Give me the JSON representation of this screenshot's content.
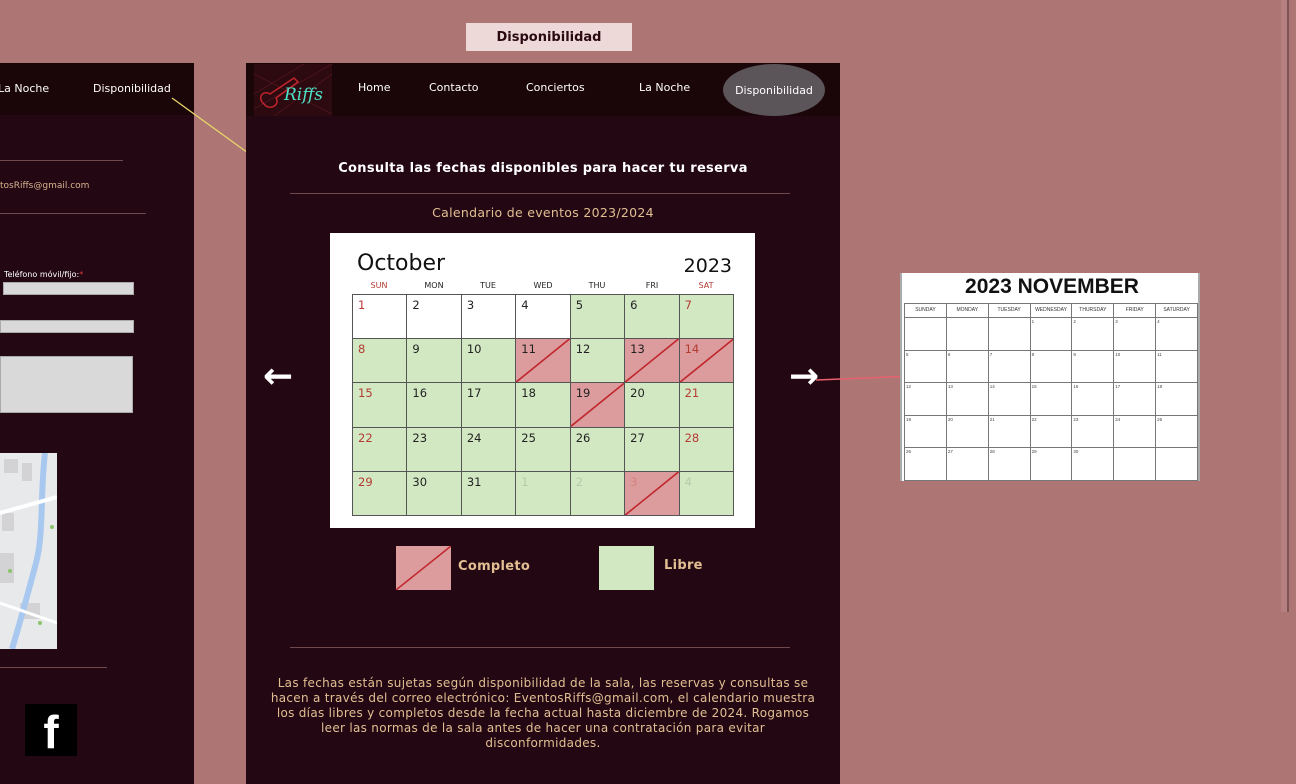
{
  "frame_label": "Disponibilidad",
  "left_frame": {
    "nav_items": [
      "La Noche",
      "Disponibilidad"
    ],
    "email_partial": "tosRiffs@gmail.com",
    "phone_label": "Teléfono móvil/fijo:",
    "required_mark": "*",
    "facebook_glyph": "f"
  },
  "nav": {
    "logo_text": "Riffs",
    "items": [
      "Home",
      "Contacto",
      "Conciertos",
      "La Noche"
    ],
    "active": "Disponibilidad"
  },
  "heading": "Consulta las fechas disponibles para hacer tu reserva",
  "subheading": "Calendario de eventos 2023/2024",
  "calendar": {
    "month": "October",
    "year": "2023",
    "days_of_week": [
      "SUN",
      "MON",
      "TUE",
      "WED",
      "THU",
      "FRI",
      "SAT"
    ],
    "rows": [
      [
        {
          "d": "1",
          "s": "white",
          "w": true
        },
        {
          "d": "2",
          "s": "white"
        },
        {
          "d": "3",
          "s": "white"
        },
        {
          "d": "4",
          "s": "white"
        },
        {
          "d": "5",
          "s": "free"
        },
        {
          "d": "6",
          "s": "free"
        },
        {
          "d": "7",
          "s": "free",
          "w": true
        }
      ],
      [
        {
          "d": "8",
          "s": "free",
          "w": true
        },
        {
          "d": "9",
          "s": "free"
        },
        {
          "d": "10",
          "s": "free"
        },
        {
          "d": "11",
          "s": "full"
        },
        {
          "d": "12",
          "s": "free"
        },
        {
          "d": "13",
          "s": "full"
        },
        {
          "d": "14",
          "s": "full",
          "w": true
        }
      ],
      [
        {
          "d": "15",
          "s": "free",
          "w": true
        },
        {
          "d": "16",
          "s": "free"
        },
        {
          "d": "17",
          "s": "free"
        },
        {
          "d": "18",
          "s": "free"
        },
        {
          "d": "19",
          "s": "full"
        },
        {
          "d": "20",
          "s": "free"
        },
        {
          "d": "21",
          "s": "free",
          "w": true
        }
      ],
      [
        {
          "d": "22",
          "s": "free",
          "w": true
        },
        {
          "d": "23",
          "s": "free"
        },
        {
          "d": "24",
          "s": "free"
        },
        {
          "d": "25",
          "s": "free"
        },
        {
          "d": "26",
          "s": "free"
        },
        {
          "d": "27",
          "s": "free"
        },
        {
          "d": "28",
          "s": "free",
          "w": true
        }
      ],
      [
        {
          "d": "29",
          "s": "free",
          "w": true
        },
        {
          "d": "30",
          "s": "free"
        },
        {
          "d": "31",
          "s": "free"
        },
        {
          "d": "1",
          "s": "free",
          "dim": true
        },
        {
          "d": "2",
          "s": "free",
          "dim": true
        },
        {
          "d": "3",
          "s": "full",
          "dim": true,
          "w": true
        },
        {
          "d": "4",
          "s": "free",
          "dim": true
        }
      ]
    ]
  },
  "legend": {
    "full_label": "Completo",
    "free_label": "Libre",
    "full_color": "#dc9c9d",
    "free_color": "#d2e8c3"
  },
  "arrows": {
    "prev": "←",
    "next": "→"
  },
  "paragraph": "Las fechas están sujetas según disponibilidad de la sala, las reservas y consultas se hacen a través del correo electrónico: EventosRiffs@gmail.com, el calendario muestra los días libres y completos desde la fecha actual hasta diciembre de 2024. Rogamos leer las normas de la sala antes de hacer una contratación para evitar disconformidades.",
  "november": {
    "title": "2023 NOVEMBER",
    "days_of_week": [
      "SUNDAY",
      "MONDAY",
      "TUESDAY",
      "WEDNESDAY",
      "THURSDAY",
      "FRIDAY",
      "SATURDAY"
    ],
    "cells": [
      "",
      "",
      "",
      "1",
      "2",
      "3",
      "4",
      "5",
      "6",
      "7",
      "8",
      "9",
      "10",
      "11",
      "12",
      "13",
      "14",
      "15",
      "16",
      "17",
      "18",
      "19",
      "20",
      "21",
      "22",
      "23",
      "24",
      "25",
      "26",
      "27",
      "28",
      "29",
      "30",
      "",
      ""
    ]
  }
}
